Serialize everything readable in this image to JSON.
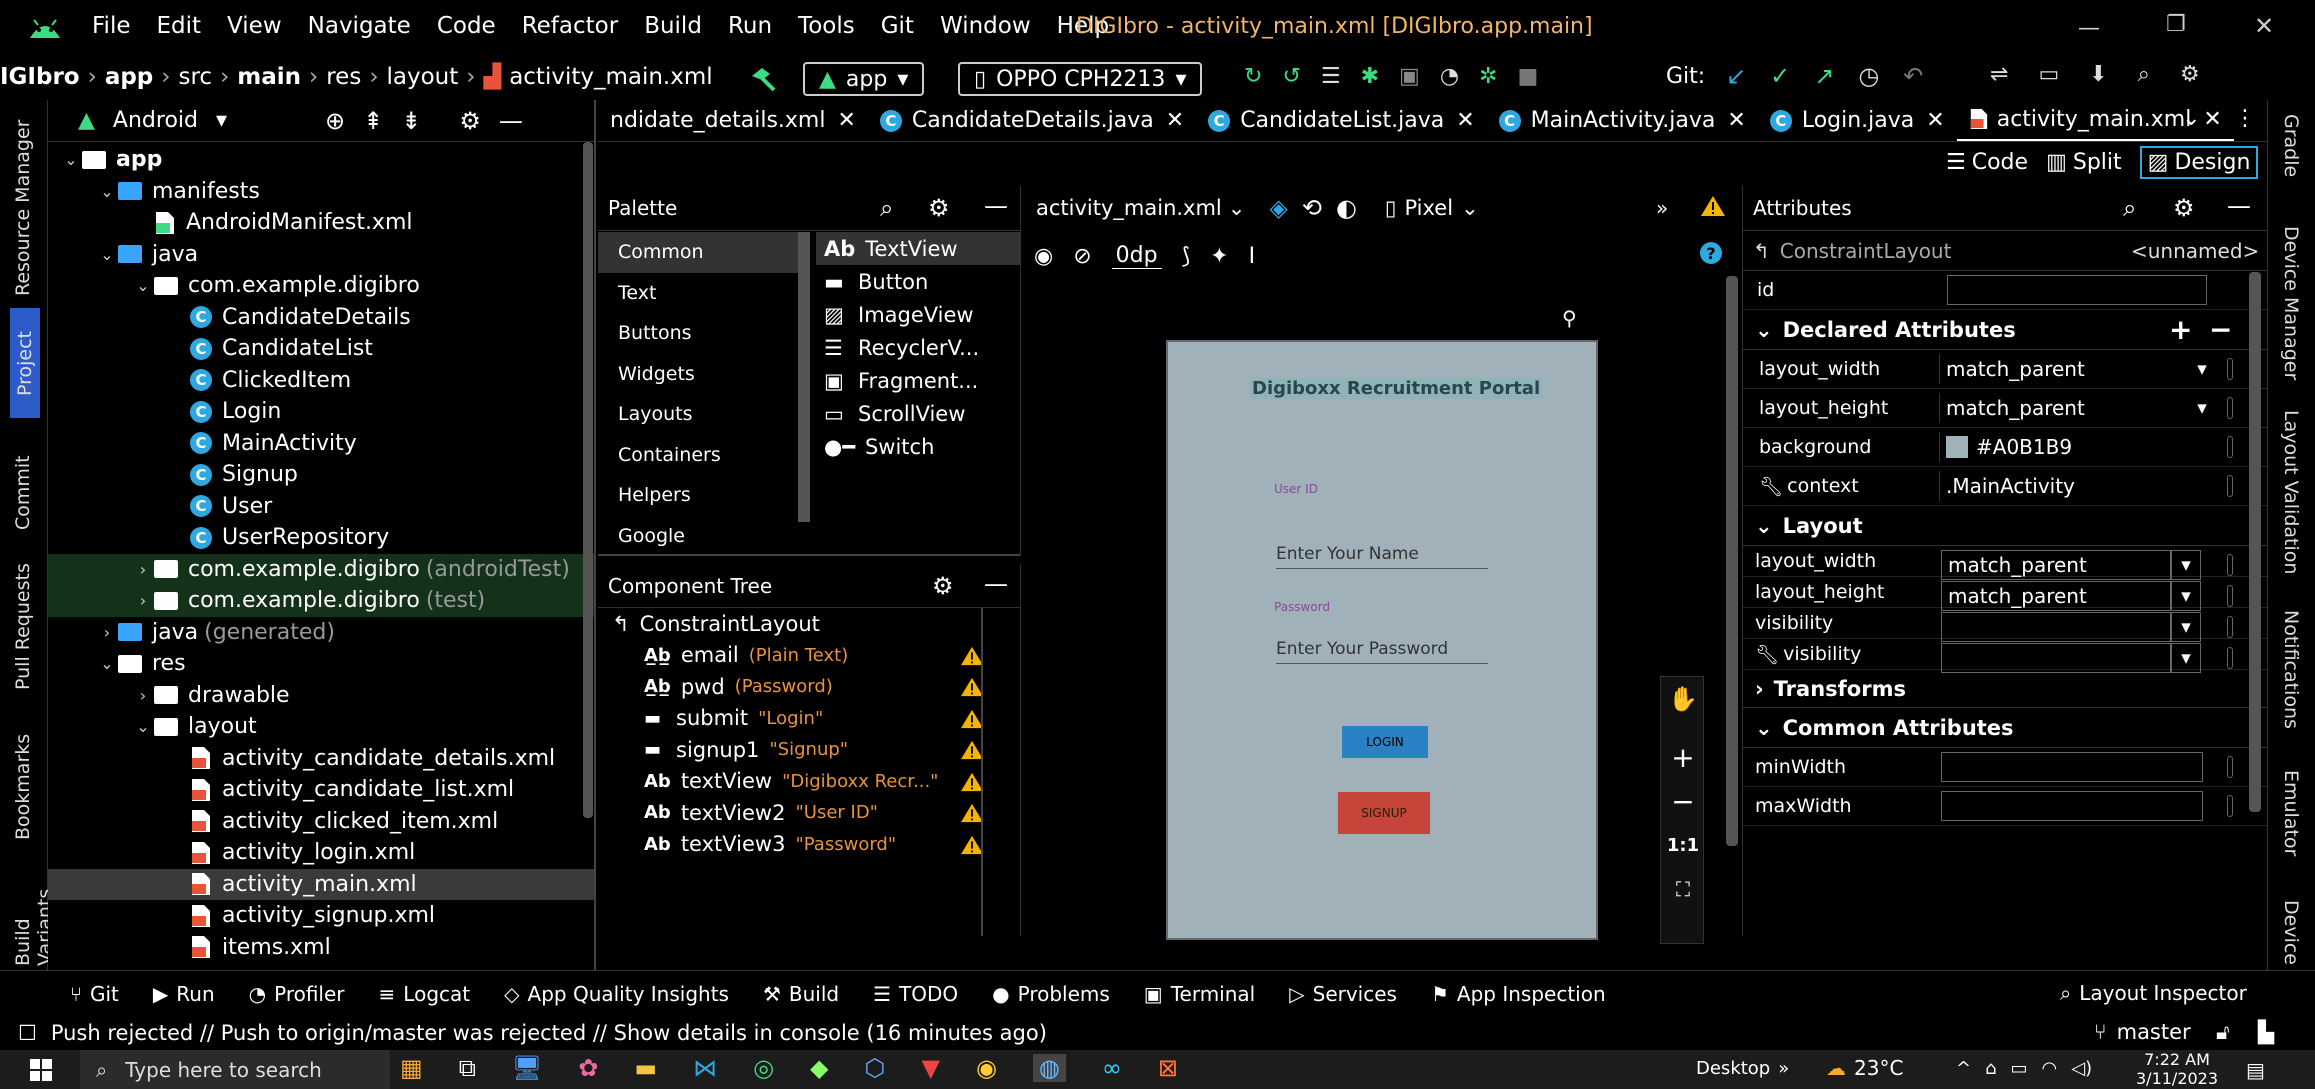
{
  "window": {
    "title": "DIGIbro - activity_main.xml [DIGIbro.app.main]",
    "menu": [
      "File",
      "Edit",
      "View",
      "Navigate",
      "Code",
      "Refactor",
      "Build",
      "Run",
      "Tools",
      "Git",
      "Window",
      "Help"
    ]
  },
  "breadcrumb": [
    "IGIbro",
    "app",
    "src",
    "main",
    "res",
    "layout",
    "activity_main.xml"
  ],
  "toolbar": {
    "run_config": "app",
    "device": "OPPO CPH2213",
    "git_label": "Git:"
  },
  "left_stripe": [
    "Resource Manager",
    "Project",
    "Commit",
    "Pull Requests",
    "Bookmarks",
    "Build Variants"
  ],
  "right_stripe": [
    "Gradle",
    "Device Manager",
    "Layout Validation",
    "Notifications",
    "Emulator",
    "Device"
  ],
  "project_panel": {
    "view_mode": "Android",
    "nodes": [
      {
        "label": "app",
        "level": 0,
        "kind": "module",
        "open": true
      },
      {
        "label": "manifests",
        "level": 1,
        "kind": "folder-blue",
        "open": true
      },
      {
        "label": "AndroidManifest.xml",
        "level": 2,
        "kind": "manifest"
      },
      {
        "label": "java",
        "level": 1,
        "kind": "folder-blue",
        "open": true
      },
      {
        "label": "com.example.digibro",
        "level": 2,
        "kind": "package",
        "open": true
      },
      {
        "label": "CandidateDetails",
        "level": 3,
        "kind": "class"
      },
      {
        "label": "CandidateList",
        "level": 3,
        "kind": "class"
      },
      {
        "label": "ClickedItem",
        "level": 3,
        "kind": "class"
      },
      {
        "label": "Login",
        "level": 3,
        "kind": "class"
      },
      {
        "label": "MainActivity",
        "level": 3,
        "kind": "class"
      },
      {
        "label": "Signup",
        "level": 3,
        "kind": "class"
      },
      {
        "label": "User",
        "level": 3,
        "kind": "class"
      },
      {
        "label": "UserRepository",
        "level": 3,
        "kind": "class"
      },
      {
        "label": "com.example.digibro",
        "suffix": "(androidTest)",
        "level": 2,
        "kind": "package",
        "open": false,
        "green": true
      },
      {
        "label": "com.example.digibro",
        "suffix": "(test)",
        "level": 2,
        "kind": "package",
        "open": false,
        "green": true
      },
      {
        "label": "java",
        "suffix": "(generated)",
        "level": 1,
        "kind": "folder-gen",
        "open": false
      },
      {
        "label": "res",
        "level": 1,
        "kind": "res",
        "open": true
      },
      {
        "label": "drawable",
        "level": 2,
        "kind": "folder",
        "open": false
      },
      {
        "label": "layout",
        "level": 2,
        "kind": "folder",
        "open": true
      },
      {
        "label": "activity_candidate_details.xml",
        "level": 3,
        "kind": "xml"
      },
      {
        "label": "activity_candidate_list.xml",
        "level": 3,
        "kind": "xml"
      },
      {
        "label": "activity_clicked_item.xml",
        "level": 3,
        "kind": "xml"
      },
      {
        "label": "activity_login.xml",
        "level": 3,
        "kind": "xml"
      },
      {
        "label": "activity_main.xml",
        "level": 3,
        "kind": "xml",
        "selected": true
      },
      {
        "label": "activity_signup.xml",
        "level": 3,
        "kind": "xml"
      },
      {
        "label": "items.xml",
        "level": 3,
        "kind": "xml"
      }
    ]
  },
  "editor_tabs": [
    {
      "label": "ndidate_details.xml",
      "kind": "none"
    },
    {
      "label": "CandidateDetails.java",
      "kind": "class"
    },
    {
      "label": "CandidateList.java",
      "kind": "class"
    },
    {
      "label": "MainActivity.java",
      "kind": "class"
    },
    {
      "label": "Login.java",
      "kind": "class"
    },
    {
      "label": "activity_main.xml",
      "kind": "xml",
      "active": true
    }
  ],
  "view_modes": [
    "Code",
    "Split",
    "Design"
  ],
  "palette": {
    "title": "Palette",
    "categories": [
      "Common",
      "Text",
      "Buttons",
      "Widgets",
      "Layouts",
      "Containers",
      "Helpers",
      "Google"
    ],
    "items": [
      {
        "icon": "Ab",
        "label": "TextView"
      },
      {
        "icon": "button",
        "label": "Button"
      },
      {
        "icon": "image",
        "label": "ImageView"
      },
      {
        "icon": "list",
        "label": "RecyclerV..."
      },
      {
        "icon": "frag",
        "label": "Fragment..."
      },
      {
        "icon": "scroll",
        "label": "ScrollView"
      },
      {
        "icon": "switch",
        "label": "Switch"
      }
    ]
  },
  "component_tree": {
    "title": "Component Tree",
    "root": "ConstraintLayout",
    "nodes": [
      {
        "icon": "Ab_",
        "id": "email",
        "detail": "(Plain Text)"
      },
      {
        "icon": "Ab_",
        "id": "pwd",
        "detail": "(Password)"
      },
      {
        "icon": "btn",
        "id": "submit",
        "detail": "\"Login\""
      },
      {
        "icon": "btn",
        "id": "signup1",
        "detail": "\"Signup\""
      },
      {
        "icon": "Ab",
        "id": "textView",
        "detail": "\"Digiboxx Recr...\""
      },
      {
        "icon": "Ab",
        "id": "textView2",
        "detail": "\"User ID\""
      },
      {
        "icon": "Ab",
        "id": "textView3",
        "detail": "\"Password\""
      }
    ]
  },
  "design_toolbar": {
    "file": "activity_main.xml",
    "device": "Pixel",
    "margin": "0dp"
  },
  "preview": {
    "background": "#A0B1B9",
    "heading": "Digiboxx Recruitment Portal",
    "user_label": "User ID",
    "name_hint": "Enter Your Name",
    "password_label": "Password",
    "password_hint": "Enter Your Password",
    "login_button": "LOGIN",
    "signup_button": "SIGNUP"
  },
  "zoom_controls": {
    "one_to_one": "1:1"
  },
  "attributes": {
    "title": "Attributes",
    "component": "ConstraintLayout",
    "component_id": "<unnamed>",
    "id_label": "id",
    "declared_title": "Declared Attributes",
    "declared": [
      {
        "name": "layout_width",
        "value": "match_parent",
        "dropdown": true
      },
      {
        "name": "layout_height",
        "value": "match_parent",
        "dropdown": true
      },
      {
        "name": "background",
        "value": "#A0B1B9",
        "swatch": "#A0B1B9"
      },
      {
        "name": "context",
        "value": ".MainActivity",
        "tool": true
      }
    ],
    "layout_title": "Layout",
    "layout": [
      {
        "name": "layout_width",
        "value": "match_parent"
      },
      {
        "name": "layout_height",
        "value": "match_parent"
      },
      {
        "name": "visibility",
        "value": ""
      },
      {
        "name": "visibility",
        "value": "",
        "tool": true
      }
    ],
    "transforms_title": "Transforms",
    "common_title": "Common Attributes",
    "common": [
      {
        "name": "minWidth",
        "value": ""
      },
      {
        "name": "maxWidth",
        "value": ""
      }
    ]
  },
  "bottom_tools": [
    "Git",
    "Run",
    "Profiler",
    "Logcat",
    "App Quality Insights",
    "Build",
    "TODO",
    "Problems",
    "Terminal",
    "Services",
    "App Inspection"
  ],
  "layout_inspector": "Layout Inspector",
  "status": {
    "message": "Push rejected // Push to origin/master was rejected // Show details in console (16 minutes ago)",
    "branch": "master"
  },
  "taskbar": {
    "search_placeholder": "Type here to search",
    "desktop": "Desktop",
    "temperature": "23°C",
    "time": "7:22 AM",
    "date": "3/11/2023"
  }
}
